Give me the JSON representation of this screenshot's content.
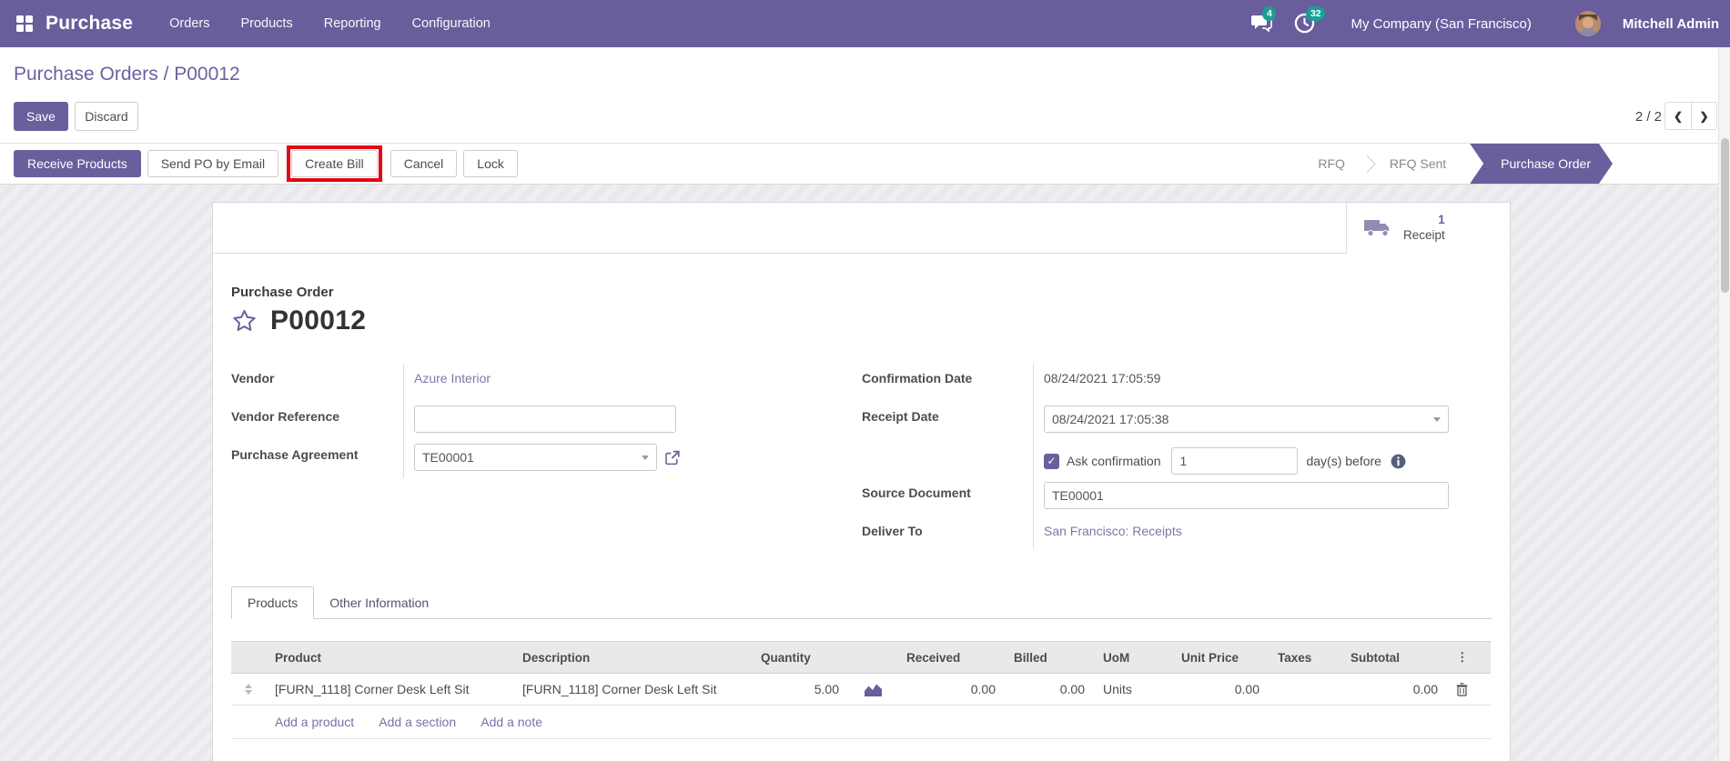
{
  "colors": {
    "primary": "#6a5e9d",
    "badge_teal": "#18a095",
    "annotation_red": "#e30613"
  },
  "navbar": {
    "app_name": "Purchase",
    "menus": [
      "Orders",
      "Products",
      "Reporting",
      "Configuration"
    ],
    "messages_badge": "4",
    "activities_badge": "32",
    "company": "My Company (San Francisco)",
    "user": "Mitchell Admin"
  },
  "breadcrumb": {
    "parent": "Purchase Orders",
    "separator": " / ",
    "current": "P00012"
  },
  "control_panel": {
    "save_label": "Save",
    "discard_label": "Discard",
    "pager": "2 / 2",
    "prev": "❮",
    "next": "❯"
  },
  "statusbar": {
    "buttons": [
      "Receive Products",
      "Send PO by Email",
      "Create Bill",
      "Cancel",
      "Lock"
    ],
    "highlighted_button": "Create Bill",
    "stages": [
      "RFQ",
      "RFQ Sent",
      "Purchase Order"
    ],
    "active_stage": "Purchase Order"
  },
  "smart_button": {
    "count": "1",
    "label": "Receipt"
  },
  "form": {
    "title_label": "Purchase Order",
    "title": "P00012",
    "left": {
      "vendor_label": "Vendor",
      "vendor_value": "Azure Interior",
      "vendor_ref_label": "Vendor Reference",
      "vendor_ref_value": "",
      "agreement_label": "Purchase Agreement",
      "agreement_value": "TE00001"
    },
    "right": {
      "confirmation_label": "Confirmation Date",
      "confirmation_value": "08/24/2021 17:05:59",
      "receipt_label": "Receipt Date",
      "receipt_value": "08/24/2021 17:05:38",
      "ask_confirmation_label": "Ask confirmation",
      "days_value": "1",
      "days_suffix": "day(s) before",
      "source_label": "Source Document",
      "source_value": "TE00001",
      "deliver_label": "Deliver To",
      "deliver_value": "San Francisco: Receipts"
    }
  },
  "tabs": [
    "Products",
    "Other Information"
  ],
  "table": {
    "headers": [
      "Product",
      "Description",
      "Quantity",
      "Received",
      "Billed",
      "UoM",
      "Unit Price",
      "Taxes",
      "Subtotal"
    ],
    "kebab": "⋮",
    "rows": [
      {
        "product": "[FURN_1118] Corner Desk Left Sit",
        "description": "[FURN_1118] Corner Desk Left Sit",
        "quantity": "5.00",
        "received": "0.00",
        "billed": "0.00",
        "uom": "Units",
        "unit_price": "0.00",
        "taxes": "",
        "subtotal": "0.00"
      }
    ],
    "links": [
      "Add a product",
      "Add a section",
      "Add a note"
    ]
  }
}
